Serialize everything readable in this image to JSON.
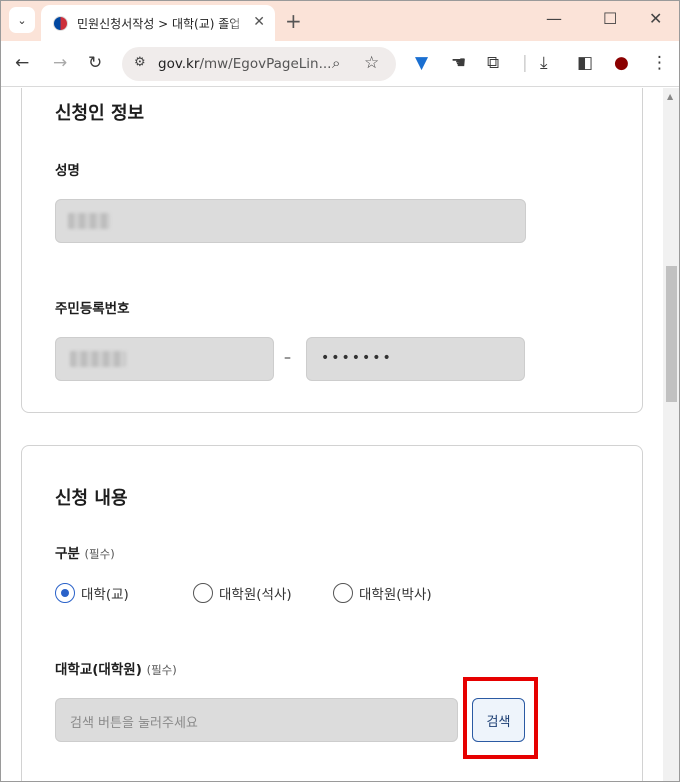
{
  "browser": {
    "tab_title": "민원신청서작성 > 대학(교) 졸업",
    "address_host": "gov.kr",
    "address_path": "/mw/EgovPageLin...",
    "icons": {
      "tab_search": "chevron-down-icon",
      "favicon": "korea-taegeuk-icon",
      "tab_close": "close-icon",
      "new_tab": "plus-icon",
      "minimize": "minimize-icon",
      "maximize": "maximize-icon",
      "close_window": "close-icon",
      "back": "back-arrow-icon",
      "forward": "forward-arrow-icon",
      "reload": "reload-icon",
      "site_settings": "tune-icon",
      "zoom": "zoom-icon",
      "bookmark": "star-icon",
      "ext1": "shield-extension-icon",
      "ext2": "hand-extension-icon",
      "extensions": "puzzle-icon",
      "download": "download-icon",
      "side_panel": "side-panel-icon",
      "profile": "profile-icon",
      "menu": "kebab-menu-icon"
    }
  },
  "applicant": {
    "section_title": "신청인 정보",
    "name_label": "성명",
    "rrn_label": "주민등록번호",
    "rrn_separator": "–",
    "rrn_back_masked": "•••••••"
  },
  "application": {
    "section_title": "신청 내용",
    "category_label": "구분",
    "required_mark": "(필수)",
    "options": [
      {
        "label": "대학(교)",
        "selected": true
      },
      {
        "label": "대학원(석사)",
        "selected": false
      },
      {
        "label": "대학원(박사)",
        "selected": false
      }
    ],
    "school_label": "대학교(대학원)",
    "school_placeholder": "검색 버튼을 눌러주세요",
    "search_button": "검색"
  },
  "colors": {
    "tab_strip": "#fbe3d8",
    "radio_selected": "#2a62c9",
    "highlight": "#e60000"
  }
}
